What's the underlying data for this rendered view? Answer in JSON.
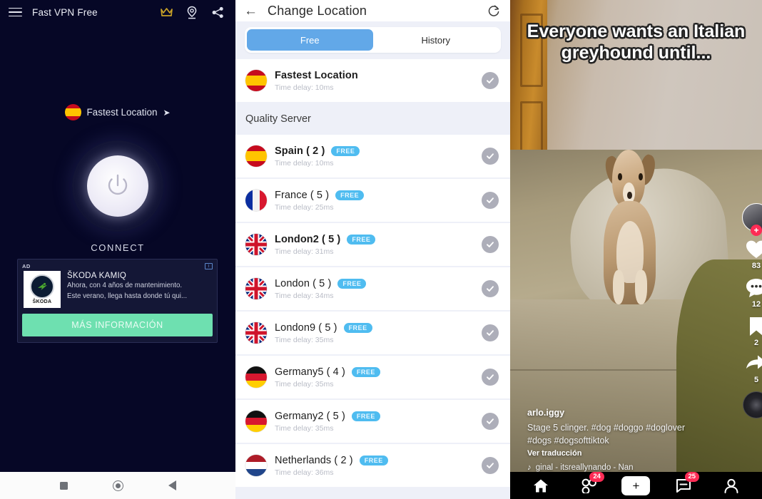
{
  "vpn": {
    "title": "Fast VPN Free",
    "icons": {
      "menu": "hamburger-menu-icon",
      "crown": "crown-icon",
      "location": "location-pin-icon",
      "share": "share-icon"
    },
    "fastest_location_label": "Fastest Location",
    "fastest_location_arrow": "➤",
    "connect_label": "CONNECT",
    "ad": {
      "tag": "AD",
      "choice_icon": "ad-choices-icon",
      "brand": "ŠKODA",
      "title": "ŠKODA KAMIQ",
      "line1": "Ahora, con 4 años de mantenimiento.",
      "line2": "Este verano, llega hasta donde tú qui...",
      "cta": "MÁS INFORMACIÓN"
    },
    "android_nav": {
      "recents": "square-recents-icon",
      "home": "circle-home-icon",
      "back": "triangle-back-icon"
    }
  },
  "location": {
    "back_icon": "back-arrow-icon",
    "title": "Change Location",
    "refresh_icon": "refresh-icon",
    "tabs": [
      {
        "label": "Free",
        "active": true
      },
      {
        "label": "History",
        "active": false
      }
    ],
    "fastest": {
      "name": "Fastest Location",
      "delay": "Time delay: 10ms",
      "flag": "es",
      "check_icon": "check-circle-icon"
    },
    "section_title": "Quality Server",
    "badge_label": "FREE",
    "servers": [
      {
        "name": "Spain ( 2 )",
        "delay": "Time delay: 10ms",
        "flag": "es",
        "badge": "FREE"
      },
      {
        "name": "France ( 5 )",
        "delay": "Time delay: 25ms",
        "flag": "fr",
        "badge": "FREE"
      },
      {
        "name": "London2 ( 5 )",
        "delay": "Time delay: 31ms",
        "flag": "gb",
        "badge": "FREE"
      },
      {
        "name": "London ( 5 )",
        "delay": "Time delay: 34ms",
        "flag": "gb",
        "badge": "FREE"
      },
      {
        "name": "London9 ( 5 )",
        "delay": "Time delay: 35ms",
        "flag": "gb",
        "badge": "FREE"
      },
      {
        "name": "Germany5 ( 4 )",
        "delay": "Time delay: 35ms",
        "flag": "de",
        "badge": "FREE"
      },
      {
        "name": "Germany2 ( 5 )",
        "delay": "Time delay: 35ms",
        "flag": "de",
        "badge": "FREE"
      },
      {
        "name": "Netherlands ( 2 )",
        "delay": "Time delay: 36ms",
        "flag": "nl",
        "badge": "FREE"
      }
    ]
  },
  "tiktok": {
    "overlay_line1": "Everyone wants an Italian",
    "overlay_line2": "greyhound until...",
    "username": "arlo.iggy",
    "description_line1": "Stage 5 clinger. #dog #doggo #doglover",
    "description_line2": "#dogs #dogsofttiktok",
    "translate_label": "Ver traducción",
    "music_icon": "music-note-icon",
    "music_label": "ginal - itsreallynando - Nan",
    "sidebar": {
      "avatar": "profile-avatar",
      "follow_icon": "plus-follow-icon",
      "like_count": "83",
      "comment_count": "12",
      "bookmark_count": "2",
      "share_count": "5",
      "disc": "music-disc-icon"
    },
    "bottom_nav": [
      {
        "icon": "home-icon",
        "badge": ""
      },
      {
        "icon": "friends-icon",
        "badge": "24"
      },
      {
        "icon": "create-icon",
        "badge": ""
      },
      {
        "icon": "inbox-icon",
        "badge": "25"
      },
      {
        "icon": "profile-icon",
        "badge": ""
      }
    ]
  },
  "colors": {
    "vpn_bg": "#060726",
    "accent_blue": "#62a8e8",
    "badge_blue": "#4fbcf0",
    "ad_green": "#6ee0b0",
    "tiktok_red": "#fe2c55",
    "tiktok_cyan": "#25f4ee"
  }
}
